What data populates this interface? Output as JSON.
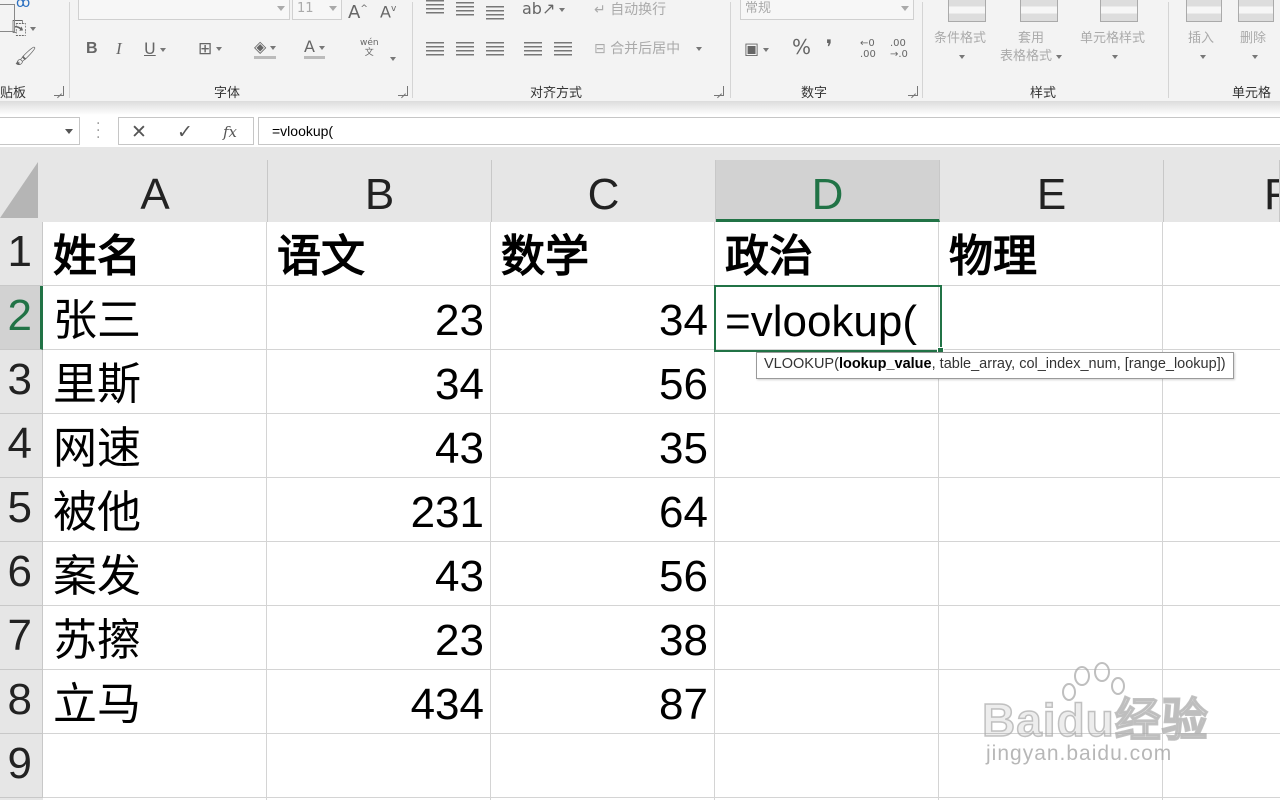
{
  "ribbon": {
    "font_size": "11",
    "wrap_text": "自动换行",
    "merge_center": "合并后居中",
    "number_format": "常规",
    "phonetic": "wén",
    "phonetic_sub": "文",
    "styles": {
      "conditional": "条件格式",
      "table_1": "套用",
      "table_2": "表格格式",
      "cell_styles": "单元格样式"
    },
    "cells": {
      "insert": "插入",
      "delete": "删除"
    },
    "groups": {
      "clipboard": "贴板",
      "font": "字体",
      "alignment": "对齐方式",
      "number": "数字",
      "styles": "样式",
      "cells": "单元格"
    }
  },
  "formula_bar": {
    "cancel": "✕",
    "enter": "✓",
    "fx": "fx",
    "value": "=vlookup("
  },
  "columns": [
    "A",
    "B",
    "C",
    "D",
    "E",
    "F"
  ],
  "rows": [
    "1",
    "2",
    "3",
    "4",
    "5",
    "6",
    "7",
    "8",
    "9"
  ],
  "table": {
    "headers": [
      "姓名",
      "语文",
      "数学",
      "政治",
      "物理"
    ],
    "data": [
      [
        "张三",
        "23",
        "34"
      ],
      [
        "里斯",
        "34",
        "56"
      ],
      [
        "网速",
        "43",
        "35"
      ],
      [
        "被他",
        "231",
        "64"
      ],
      [
        "案发",
        "43",
        "56"
      ],
      [
        "苏擦",
        "23",
        "38"
      ],
      [
        "立马",
        "434",
        "87"
      ]
    ]
  },
  "active_cell": {
    "column": "D",
    "row": "2",
    "editing_text": "=vlookup("
  },
  "tooltip": {
    "func": "VLOOKUP(",
    "arg_bold": "lookup_value",
    "rest": ", table_array, col_index_num, [range_lookup])"
  },
  "watermark": {
    "logo": "Baidu经验",
    "url": "jingyan.baidu.com"
  },
  "colors": {
    "accent": "#217346",
    "header_bg": "#e6e6e6",
    "selected_header_bg": "#d2d2d2",
    "gridline": "#d4d4d4"
  },
  "icons": [
    "format-painter-icon",
    "copy-icon",
    "bold-icon",
    "italic-icon",
    "underline-icon",
    "border-icon",
    "fill-color-icon",
    "font-color-icon",
    "percent-icon"
  ]
}
